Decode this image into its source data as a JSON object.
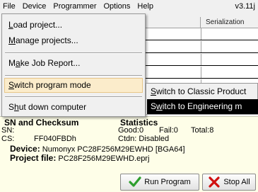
{
  "menubar": {
    "items": [
      "File",
      "Device",
      "Programmer",
      "Options",
      "Help"
    ],
    "version": "v3.11j"
  },
  "grid": {
    "header_col2": "Serialization"
  },
  "dropdown": {
    "load_project": "Load project...",
    "manage_projects": "Manage projects...",
    "make_job_report": "Make Job Report...",
    "switch_program_mode": "Switch program mode",
    "shut_down_computer": "Shut down computer"
  },
  "submenu": {
    "classic": "Switch to Classic Product",
    "engineering": "Switch to Engineering m"
  },
  "info": {
    "sn_checksum_title": "SN and Checksum",
    "statistics_title": "Statistics",
    "sn_label": "SN:",
    "cs_label": "CS:",
    "cs_value": "FF040FBDh",
    "good": "Good:0",
    "fail": "Fail:0",
    "total": "Total:8",
    "ctdn": "Ctdn: Disabled",
    "device_label": "Device:",
    "device_value": "Numonyx PC28F256M29EWHD [BGA64]",
    "project_label": "Project file:",
    "project_value": "PC28F256M29EWHD.eprj"
  },
  "buttons": {
    "run_program": "Run Program",
    "stop_all": "Stop All"
  },
  "colors": {
    "highlight": "#fbeccb",
    "info_bg": "#fefee8",
    "run_icon": "#2e9e2e",
    "stop_icon": "#d01010"
  }
}
